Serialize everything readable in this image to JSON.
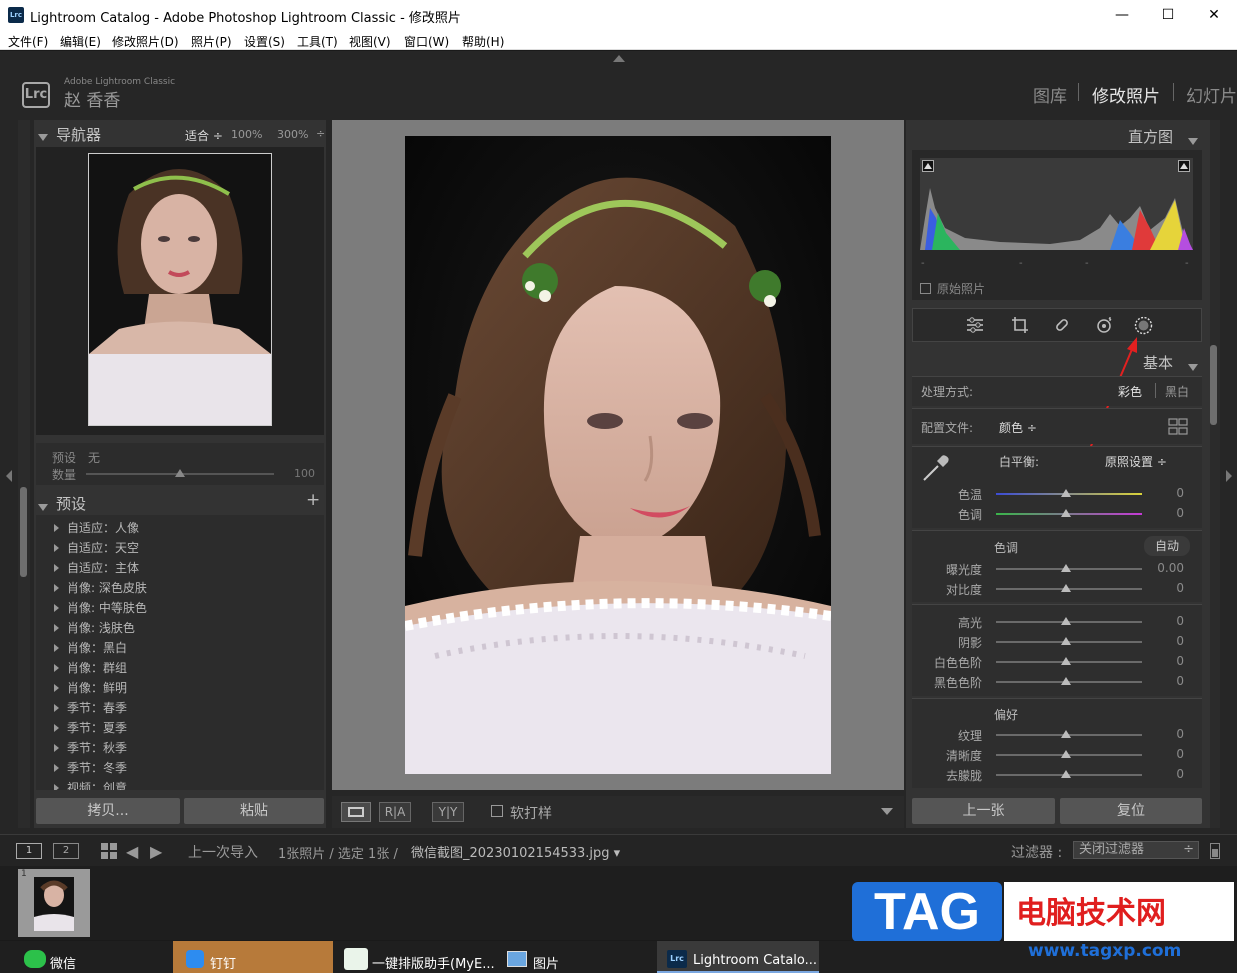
{
  "window": {
    "title": "Lightroom Catalog - Adobe Photoshop Lightroom Classic - 修改照片",
    "app_icon": "Lrc",
    "minimize": "—",
    "maximize": "☐",
    "close": "✕"
  },
  "menu": [
    "文件(F)",
    "编辑(E)",
    "修改照片(D)",
    "照片(P)",
    "设置(S)",
    "工具(T)",
    "视图(V)",
    "窗口(W)",
    "帮助(H)"
  ],
  "identity": {
    "logo": "Lrc",
    "product": "Adobe Lightroom Classic",
    "user": "赵 香香"
  },
  "modules": [
    "图库",
    "修改照片",
    "幻灯片"
  ],
  "navigator": {
    "title": "导航器",
    "zoom_fit": "适合",
    "zoom_100": "100%",
    "zoom_300": "300%"
  },
  "preset_amount": {
    "preset_label": "预设",
    "preset_value": "无",
    "amount_label": "数量",
    "amount_value": "100"
  },
  "presets": {
    "title": "预设",
    "add": "+",
    "items": [
      "自适应：人像",
      "自适应：天空",
      "自适应：主体",
      "肖像: 深色皮肤",
      "肖像: 中等肤色",
      "肖像: 浅肤色",
      "肖像：黑白",
      "肖像：群组",
      "肖像：鲜明",
      "季节：春季",
      "季节：夏季",
      "季节：秋季",
      "季节：冬季",
      "视频：创意"
    ]
  },
  "left_buttons": {
    "copy": "拷贝...",
    "paste": "粘贴"
  },
  "toolbar": {
    "softproof": "软打样"
  },
  "histogram": {
    "title": "直方图",
    "original": "原始照片"
  },
  "basic": {
    "title": "基本",
    "treatment_label": "处理方式:",
    "color": "彩色",
    "bw": "黑白",
    "profile_label": "配置文件:",
    "profile_value": "颜色",
    "wb_label": "白平衡:",
    "wb_value": "原照设置",
    "temp": "色温",
    "tint": "色调",
    "temp_val": "0",
    "tint_val": "0",
    "tone_label": "色调",
    "auto": "自动",
    "exposure": "曝光度",
    "exposure_val": "0.00",
    "contrast": "对比度",
    "contrast_val": "0",
    "highlights": "高光",
    "highlights_val": "0",
    "shadows": "阴影",
    "shadows_val": "0",
    "whites": "白色色阶",
    "whites_val": "0",
    "blacks": "黑色色阶",
    "blacks_val": "0",
    "presence_label": "偏好",
    "texture": "纹理",
    "texture_val": "0",
    "clarity": "清晰度",
    "clarity_val": "0",
    "dehaze": "去朦胧",
    "dehaze_val": "0"
  },
  "right_buttons": {
    "prev": "上一张",
    "reset": "复位"
  },
  "filmstrip_bar": {
    "page1": "1",
    "page2": "2",
    "source": "上一次导入",
    "count": "1张照片 / 选定 1张 /",
    "filename": "微信截图_20230102154533.jpg",
    "filter_label": "过滤器 :",
    "filter_value": "关闭过滤器"
  },
  "watermark": {
    "tag": "TAG",
    "title": "电脑技术网",
    "url": "www.tagxp.com"
  },
  "taskbar": [
    "微信",
    "钉钉",
    "一键排版助手(MyE...",
    "图片",
    "Lightroom Catalo..."
  ]
}
